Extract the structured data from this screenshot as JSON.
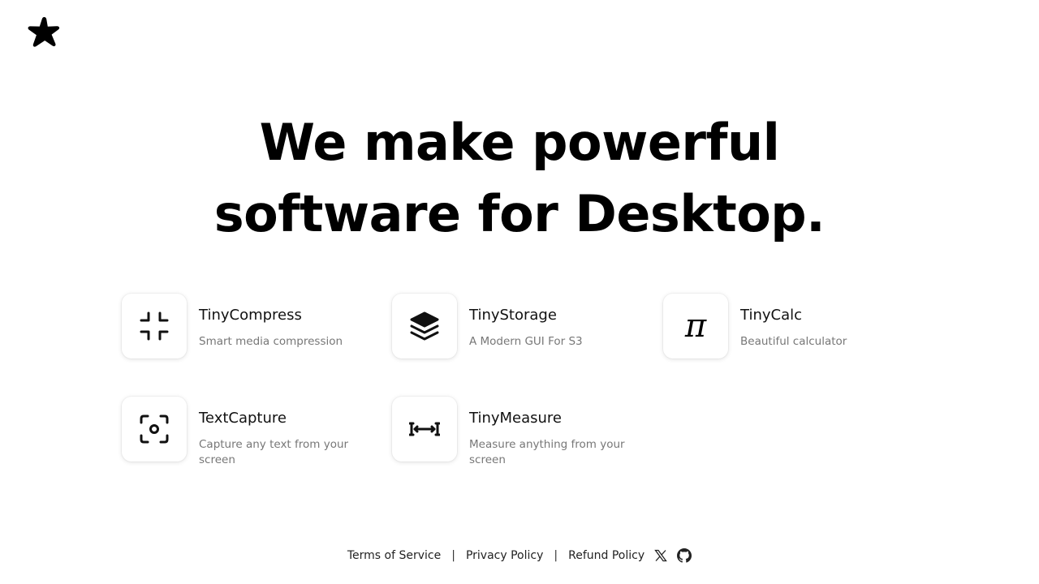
{
  "hero": {
    "line1": "We make powerful",
    "line2": "software for Desktop."
  },
  "products": [
    {
      "name": "TinyCompress",
      "description": "Smart media compression",
      "icon": "compress-icon"
    },
    {
      "name": "TinyStorage",
      "description": "A Modern GUI For S3",
      "icon": "layers-icon"
    },
    {
      "name": "TinyCalc",
      "description": "Beautiful calculator",
      "icon": "pi-icon",
      "glyph": "π"
    },
    {
      "name": "TextCapture",
      "description": "Capture any text from your screen",
      "icon": "scan-icon"
    },
    {
      "name": "TinyMeasure",
      "description": "Measure anything from your screen",
      "icon": "ruler-icon"
    }
  ],
  "footer": {
    "links": [
      "Terms of Service",
      "Privacy Policy",
      "Refund Policy"
    ],
    "separator": "|",
    "social": [
      "x-icon",
      "github-icon"
    ]
  },
  "colors": {
    "text": "#000000",
    "muted": "#777777",
    "background": "#ffffff"
  }
}
